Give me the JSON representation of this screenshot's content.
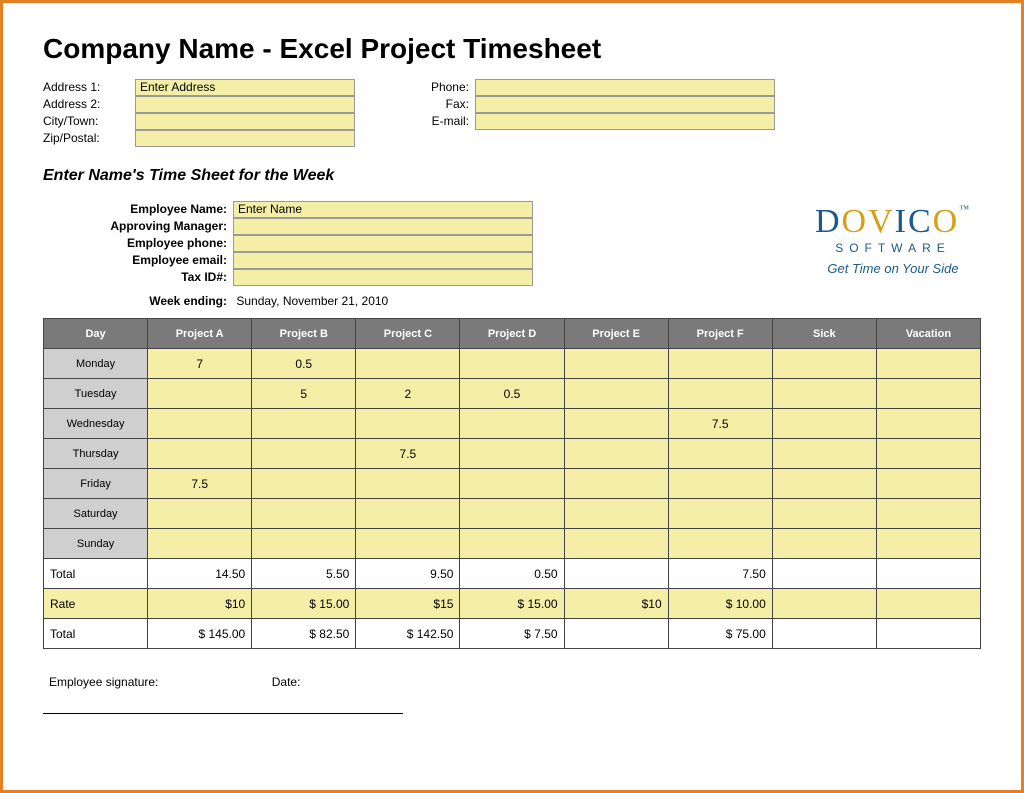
{
  "title": "Company Name - Excel Project Timesheet",
  "company": {
    "address1_label": "Address 1:",
    "address1_value": "Enter Address",
    "address2_label": "Address 2:",
    "address2_value": "",
    "city_label": "City/Town:",
    "city_value": "",
    "zip_label": "Zip/Postal:",
    "zip_value": "",
    "phone_label": "Phone:",
    "phone_value": "",
    "fax_label": "Fax:",
    "fax_value": "",
    "email_label": "E-mail:",
    "email_value": ""
  },
  "subtitle": "Enter Name's Time Sheet for the Week",
  "employee": {
    "name_label": "Employee Name:",
    "name_value": "Enter Name",
    "manager_label": "Approving Manager:",
    "manager_value": "",
    "phone_label": "Employee phone:",
    "phone_value": "",
    "email_label": "Employee email:",
    "email_value": "",
    "tax_label": "Tax ID#:",
    "tax_value": ""
  },
  "logo": {
    "brand": "DOVICO",
    "sub": "SOFTWARE",
    "tagline": "Get Time on Your Side"
  },
  "week_ending": {
    "label": "Week ending:",
    "value": "Sunday, November 21, 2010"
  },
  "columns": [
    "Day",
    "Project A",
    "Project B",
    "Project C",
    "Project D",
    "Project E",
    "Project F",
    "Sick",
    "Vacation"
  ],
  "rows": [
    {
      "day": "Monday",
      "cells": [
        "7",
        "0.5",
        "",
        "",
        "",
        "",
        "",
        ""
      ]
    },
    {
      "day": "Tuesday",
      "cells": [
        "",
        "5",
        "2",
        "0.5",
        "",
        "",
        "",
        ""
      ]
    },
    {
      "day": "Wednesday",
      "cells": [
        "",
        "",
        "",
        "",
        "",
        "7.5",
        "",
        ""
      ]
    },
    {
      "day": "Thursday",
      "cells": [
        "",
        "",
        "7.5",
        "",
        "",
        "",
        "",
        ""
      ]
    },
    {
      "day": "Friday",
      "cells": [
        "7.5",
        "",
        "",
        "",
        "",
        "",
        "",
        ""
      ]
    },
    {
      "day": "Saturday",
      "cells": [
        "",
        "",
        "",
        "",
        "",
        "",
        "",
        ""
      ]
    },
    {
      "day": "Sunday",
      "cells": [
        "",
        "",
        "",
        "",
        "",
        "",
        "",
        ""
      ]
    }
  ],
  "totals": {
    "label": "Total",
    "values": [
      "14.50",
      "5.50",
      "9.50",
      "0.50",
      "",
      "7.50",
      "",
      ""
    ]
  },
  "rates": {
    "label": "Rate",
    "pairs": [
      {
        "sym": "$10",
        "val": "$        15.00"
      },
      {
        "sym": "$15",
        "val": "$        15.00"
      },
      {
        "sym": "$10",
        "val": "$        10.00"
      }
    ]
  },
  "grand": {
    "label": "Total",
    "values": [
      "$       145.00",
      "$         82.50",
      "$       142.50",
      "$           7.50",
      "",
      "$         75.00",
      "",
      ""
    ]
  },
  "signatures": {
    "employee": "Employee signature:",
    "date": "Date:"
  }
}
